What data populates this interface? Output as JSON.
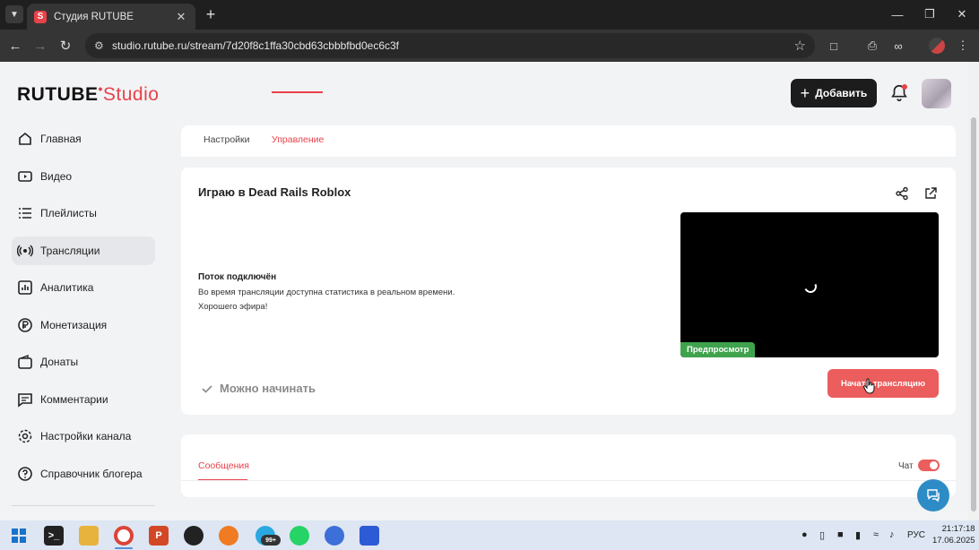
{
  "browser": {
    "tab_title": "Студия RUTUBE",
    "tab_favicon": "S",
    "url": "studio.rutube.ru/stream/7d20f8c1ffa30cbd63cbbbfbd0ec6c3f",
    "new_tab_label": "+",
    "icons": [
      "tab-list-icon",
      "close-icon",
      "minimize-icon",
      "restore-icon",
      "window-close-icon",
      "back-icon",
      "forward-icon",
      "reload-icon",
      "site-info-icon",
      "bookmark-star-icon",
      "extensions-icon",
      "print-icon",
      "link-icon",
      "profile-icon"
    ]
  },
  "header": {
    "logo_main": "RUTUBE",
    "logo_dot": "•",
    "logo_studio": "Studio",
    "add_button": "Добавить"
  },
  "sidebar": {
    "items": [
      {
        "label": "Главная",
        "icon": "home-icon",
        "active": false
      },
      {
        "label": "Видео",
        "icon": "video-icon",
        "active": false
      },
      {
        "label": "Плейлисты",
        "icon": "playlist-icon",
        "active": false
      },
      {
        "label": "Трансляции",
        "icon": "broadcast-icon",
        "active": true
      },
      {
        "label": "Аналитика",
        "icon": "analytics-icon",
        "active": false
      },
      {
        "label": "Монетизация",
        "icon": "monetization-icon",
        "active": false
      },
      {
        "label": "Донаты",
        "icon": "wallet-icon",
        "active": false
      },
      {
        "label": "Комментарии",
        "icon": "comment-icon",
        "active": false
      },
      {
        "label": "Настройки канала",
        "icon": "settings-icon",
        "active": false
      },
      {
        "label": "Справочник блогера",
        "icon": "help-icon",
        "active": false
      }
    ]
  },
  "page_tabs": {
    "settings": "Настройки",
    "manage": "Управление"
  },
  "stream": {
    "title": "Играю в Dead Rails Roblox",
    "status_title": "Поток подключён",
    "status_line1": "Во время трансляции доступна статистика в реальном времени.",
    "status_line2": "Хорошего эфира!",
    "preview_badge": "Предпросмотр",
    "ready_text": "Можно начинать",
    "start_button": "Начать трансляцию"
  },
  "chat": {
    "messages_tab": "Сообщения",
    "chat_label": "Чат",
    "chat_enabled": true
  },
  "taskbar": {
    "notification_badge": "99+",
    "language": "РУС",
    "time": "21:17:18",
    "date": "17.06.2025"
  },
  "colors": {
    "accent": "#e8424a",
    "start_button": "#ec5d5d",
    "preview_badge": "#3fa34d",
    "dark_button": "#1c1c1c",
    "support": "#2d8cc6"
  }
}
